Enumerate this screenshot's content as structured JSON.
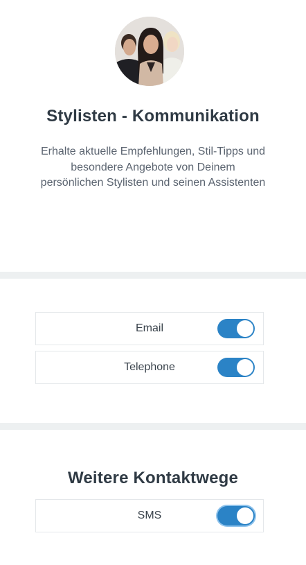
{
  "header": {
    "avatar_alt": "Stylisten-Team",
    "title": "Stylisten - Kommunikation",
    "description": "Erhalte aktuelle Empfehlungen, Stil-Tipps und besondere Angebote von Deinem persönlichen Stylisten und seinen Assistenten"
  },
  "channels": [
    {
      "label": "Email",
      "enabled": true
    },
    {
      "label": "Telephone",
      "enabled": true
    }
  ],
  "more": {
    "title": "Weitere Kontaktwege",
    "items": [
      {
        "label": "SMS",
        "enabled": true
      }
    ]
  },
  "colors": {
    "toggle_on": "#2b83c6",
    "divider": "#edf0f1",
    "text": "#2f3a44"
  }
}
